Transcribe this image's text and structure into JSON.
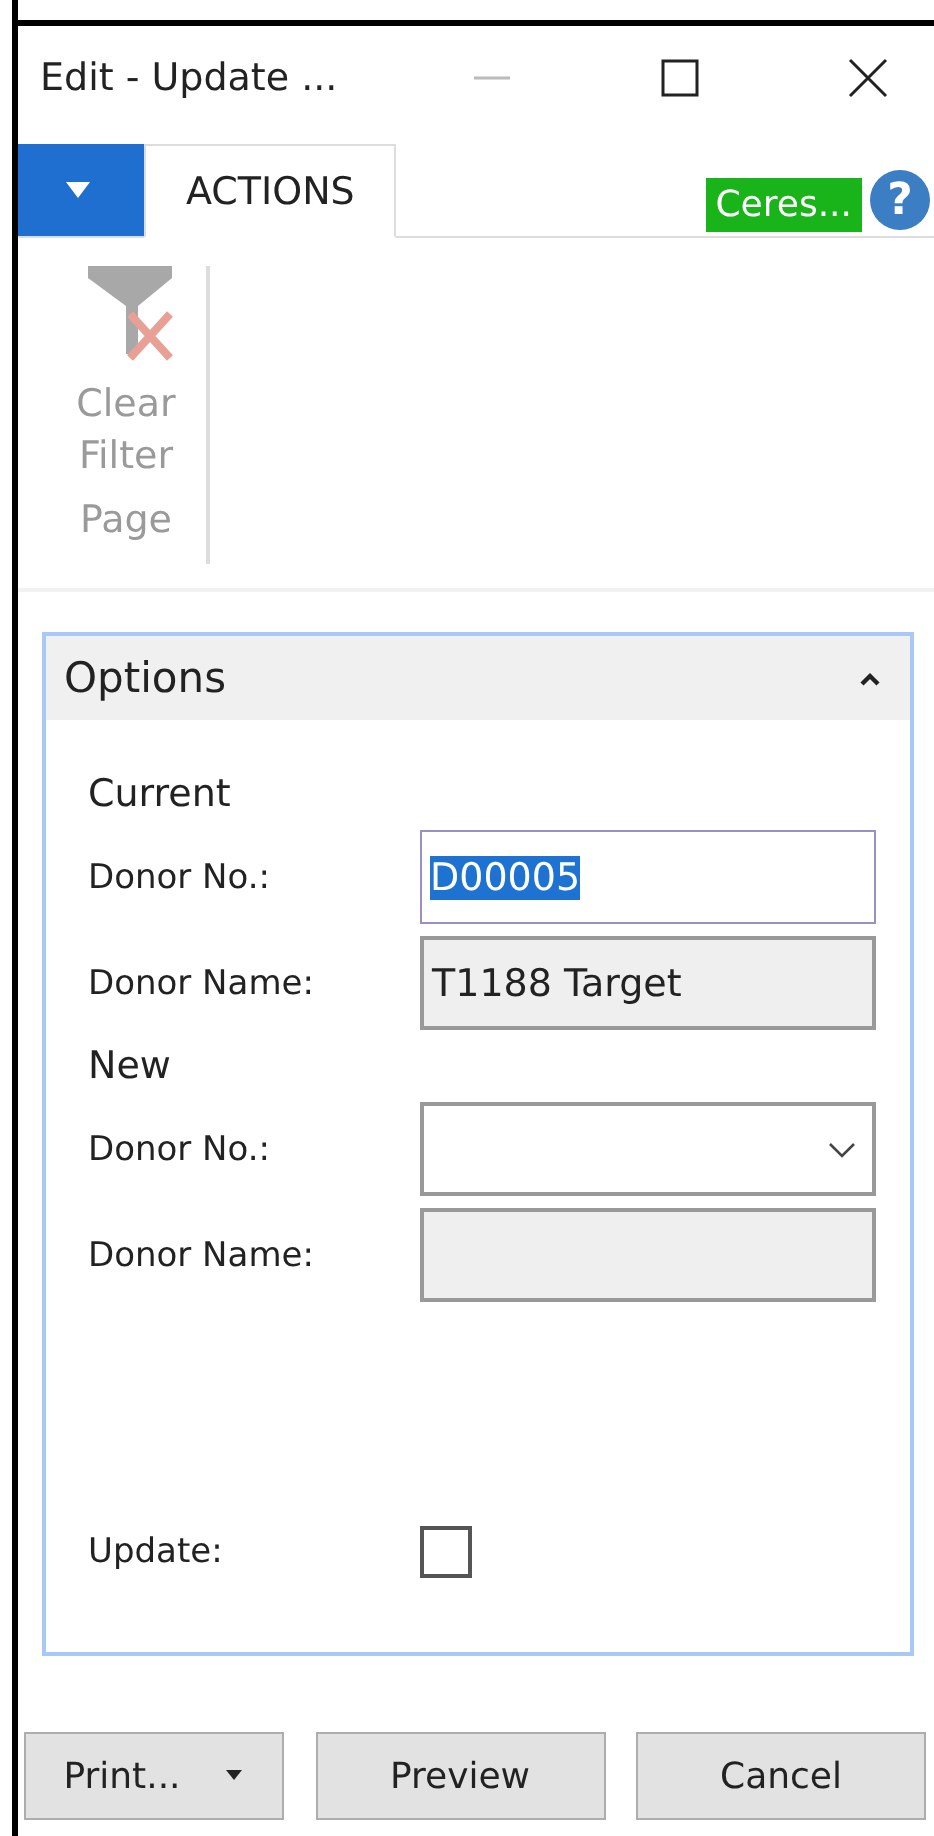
{
  "window": {
    "title": "Edit - Update ..."
  },
  "ribbon": {
    "tabs": [
      {
        "label": "ACTIONS",
        "selected": true
      }
    ],
    "company": "Ceres...",
    "help": "?",
    "groups": [
      {
        "label": "Page",
        "actions": [
          {
            "label": "Clear Filter",
            "disabled": true
          }
        ]
      }
    ]
  },
  "options": {
    "title": "Options",
    "expanded": true,
    "sections": [
      {
        "title": "Current",
        "fields": [
          {
            "label": "Donor No.:",
            "kind": "text",
            "value": "D00005",
            "selected": true
          },
          {
            "label": "Donor Name:",
            "kind": "readonly",
            "value": "T1188 Target"
          }
        ]
      },
      {
        "title": "New",
        "fields": [
          {
            "label": "Donor No.:",
            "kind": "dropdown"
          },
          {
            "label": "Donor Name:",
            "kind": "readonly"
          }
        ]
      }
    ],
    "update": {
      "label": "Update:",
      "checked": false
    }
  },
  "buttons": [
    {
      "label": "Print...",
      "kind": "split"
    },
    {
      "label": "Preview",
      "kind": "plain"
    },
    {
      "label": "Cancel",
      "kind": "plain"
    }
  ]
}
